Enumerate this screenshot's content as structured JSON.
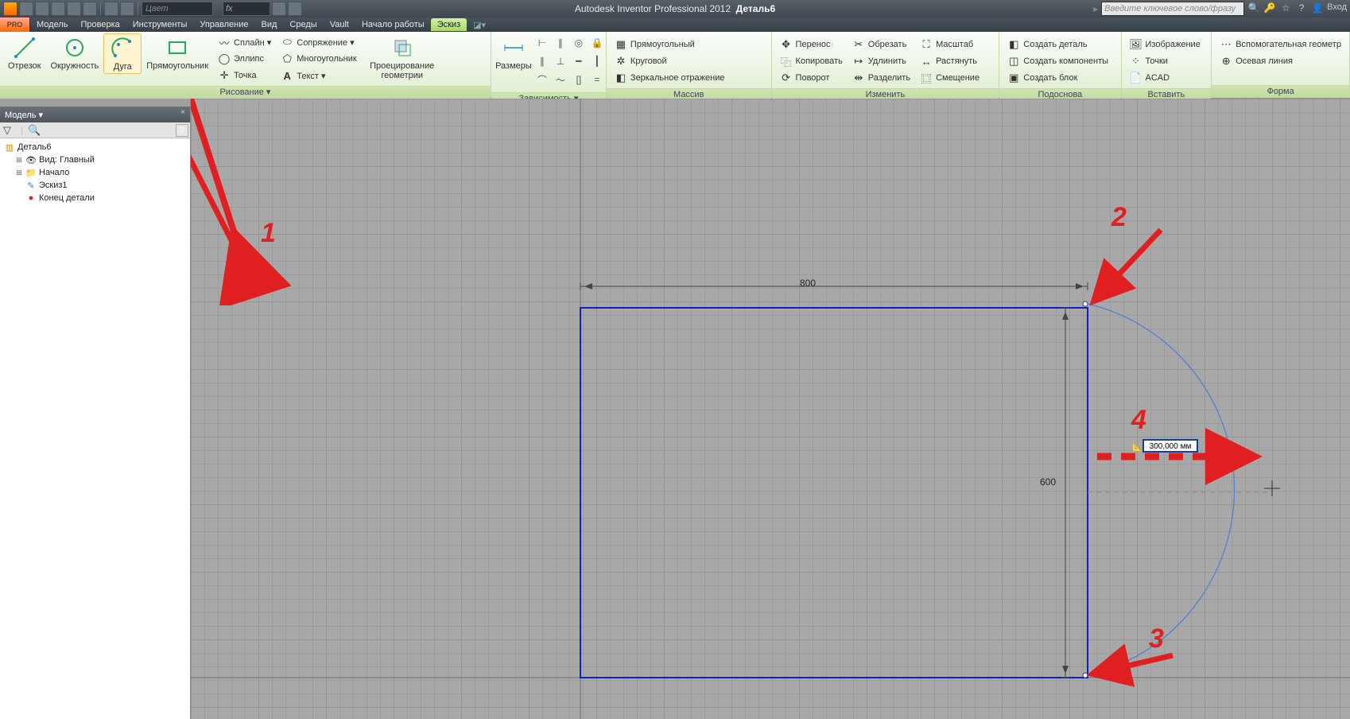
{
  "title": {
    "app": "Autodesk Inventor Professional 2012",
    "doc": "Деталь6"
  },
  "qat_color_placeholder": "Цвет",
  "search_placeholder": "Введите ключевое слово/фразу",
  "login_label": "Вход",
  "menus": [
    "Модель",
    "Проверка",
    "Инструменты",
    "Управление",
    "Вид",
    "Среды",
    "Vault",
    "Начало работы",
    "Эскиз"
  ],
  "active_menu_index": 8,
  "ribbon": {
    "draw": {
      "title": "Рисование ▾",
      "line": "Отрезок",
      "circle": "Окружность",
      "arc": "Дуга",
      "rect": "Прямоугольник",
      "spline": "Сплайн ▾",
      "ellipse": "Эллипс",
      "point": "Точка",
      "fillet": "Сопряжение ▾",
      "polygon": "Многоугольник",
      "text": "Текст ▾",
      "project": "Проецирование геометрии"
    },
    "constrain": {
      "title": "Зависимость ▾",
      "dims": "Размеры"
    },
    "array": {
      "title": "Массив",
      "rect": "Прямоугольный",
      "circ": "Круговой",
      "mirror": "Зеркальное отражение"
    },
    "modify": {
      "title": "Изменить",
      "move": "Перенос",
      "copy": "Копировать",
      "rotate": "Поворот",
      "trim": "Обрезать",
      "extend": "Удлинить",
      "split": "Разделить",
      "scale": "Масштаб",
      "stretch": "Растянуть",
      "offset": "Смещение"
    },
    "layout": {
      "title": "Подоснова",
      "part": "Создать деталь",
      "comp": "Создать компоненты",
      "block": "Создать блок"
    },
    "insert": {
      "title": "Вставить",
      "image": "Изображение",
      "points": "Точки",
      "acad": "ACAD"
    },
    "format": {
      "title": "Форма",
      "construction": "Вспомогательная геометр",
      "centerline": "Осевая линия"
    }
  },
  "browser": {
    "title": "Модель ▾",
    "root": "Деталь6",
    "view": "Вид: Главный",
    "origin": "Начало",
    "sketch": "Эскиз1",
    "eop": "Конец детали"
  },
  "canvas": {
    "dim_w": "800",
    "dim_h": "600",
    "input_value": "300,000 мм"
  },
  "callouts": {
    "c1": "1",
    "c2": "2",
    "c3": "3",
    "c4": "4"
  }
}
